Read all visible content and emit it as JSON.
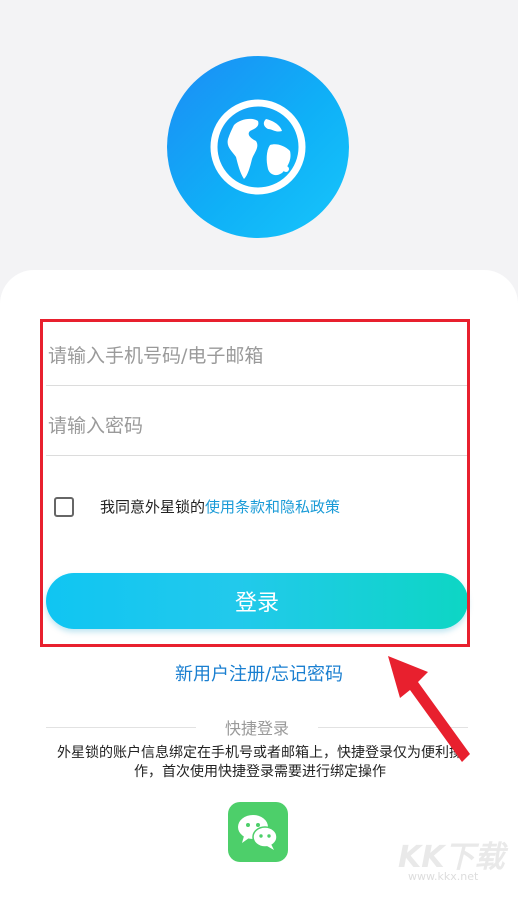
{
  "login": {
    "phone_placeholder": "请输入手机号码/电子邮箱",
    "password_placeholder": "请输入密码",
    "agree_text": "我同意外星锁的",
    "terms_link": "使用条款和隐私政策",
    "login_button": "登录",
    "register_forgot": "新用户注册/忘记密码"
  },
  "quick_login": {
    "title": "快捷登录",
    "description": "外星锁的账户信息绑定在手机号或者邮箱上，快捷登录仅为便利操作，首次使用快捷登录需要进行绑定操作"
  },
  "watermark": {
    "brand": "KK下载",
    "url": "www.kkx.net"
  },
  "colors": {
    "accent": "#1a9bd7",
    "button_start": "#10c5f2",
    "button_end": "#0dd6c4",
    "highlight": "#e8202e",
    "wechat": "#4dcf6a"
  },
  "icons": {
    "logo": "globe-icon",
    "quick_login": "wechat-icon",
    "annotation": "red-arrow"
  }
}
